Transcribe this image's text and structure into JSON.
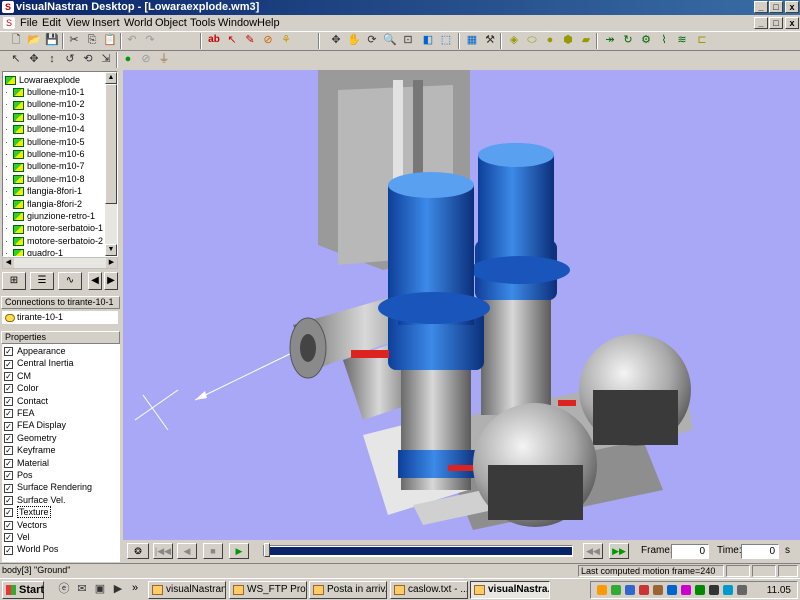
{
  "window": {
    "title": "visualNastran Desktop - [Lowaraexplode.wm3]",
    "min": "_",
    "max": "□",
    "close": "x"
  },
  "menu": [
    "File",
    "Edit",
    "View",
    "Insert",
    "World",
    "Object",
    "Tools",
    "Window",
    "Help"
  ],
  "toolbar": {
    "text_tool": "ab"
  },
  "tree": {
    "root": "Lowaraexplode",
    "items": [
      "bullone-m10-1",
      "bullone-m10-2",
      "bullone-m10-3",
      "bullone-m10-4",
      "bullone-m10-5",
      "bullone-m10-6",
      "bullone-m10-7",
      "bullone-m10-8",
      "flangia-8fori-1",
      "flangia-8fori-2",
      "giunzione-retro-1",
      "motore-serbatoio-1",
      "motore-serbatoio-2",
      "quadro-1"
    ]
  },
  "connections": {
    "header": "Connections to tirante-10-1",
    "items": [
      "tirante-10-1"
    ]
  },
  "properties": {
    "header": "Properties",
    "items": [
      "Appearance",
      "Central Inertia",
      "CM",
      "Color",
      "Contact",
      "FEA",
      "FEA Display",
      "Geometry",
      "Keyframe",
      "Material",
      "Pos",
      "Surface Rendering",
      "Surface Vel.",
      "Texture",
      "Vectors",
      "Vel",
      "World Pos"
    ],
    "selected": "Texture"
  },
  "playback": {
    "frame_label": "Frame:",
    "frame_value": "0",
    "time_label": "Time:",
    "time_value": "0",
    "time_unit": "s",
    "progress": 1.0
  },
  "status": {
    "selection": "body[3] \"Ground\"",
    "motion": "Last computed motion frame=240"
  },
  "taskbar": {
    "start": "Start",
    "chevron": "»",
    "tasks": [
      "visualNastran",
      "WS_FTP Pro ...",
      "Posta in arriv...",
      "caslow.txt - ...",
      "visualNastra..."
    ],
    "active": 4,
    "clock": "11.05"
  },
  "colors": {
    "viewport_bg": "#a8a8f6",
    "title_grad_start": "#0a246a",
    "motor_blue": "#1f6fd6"
  }
}
